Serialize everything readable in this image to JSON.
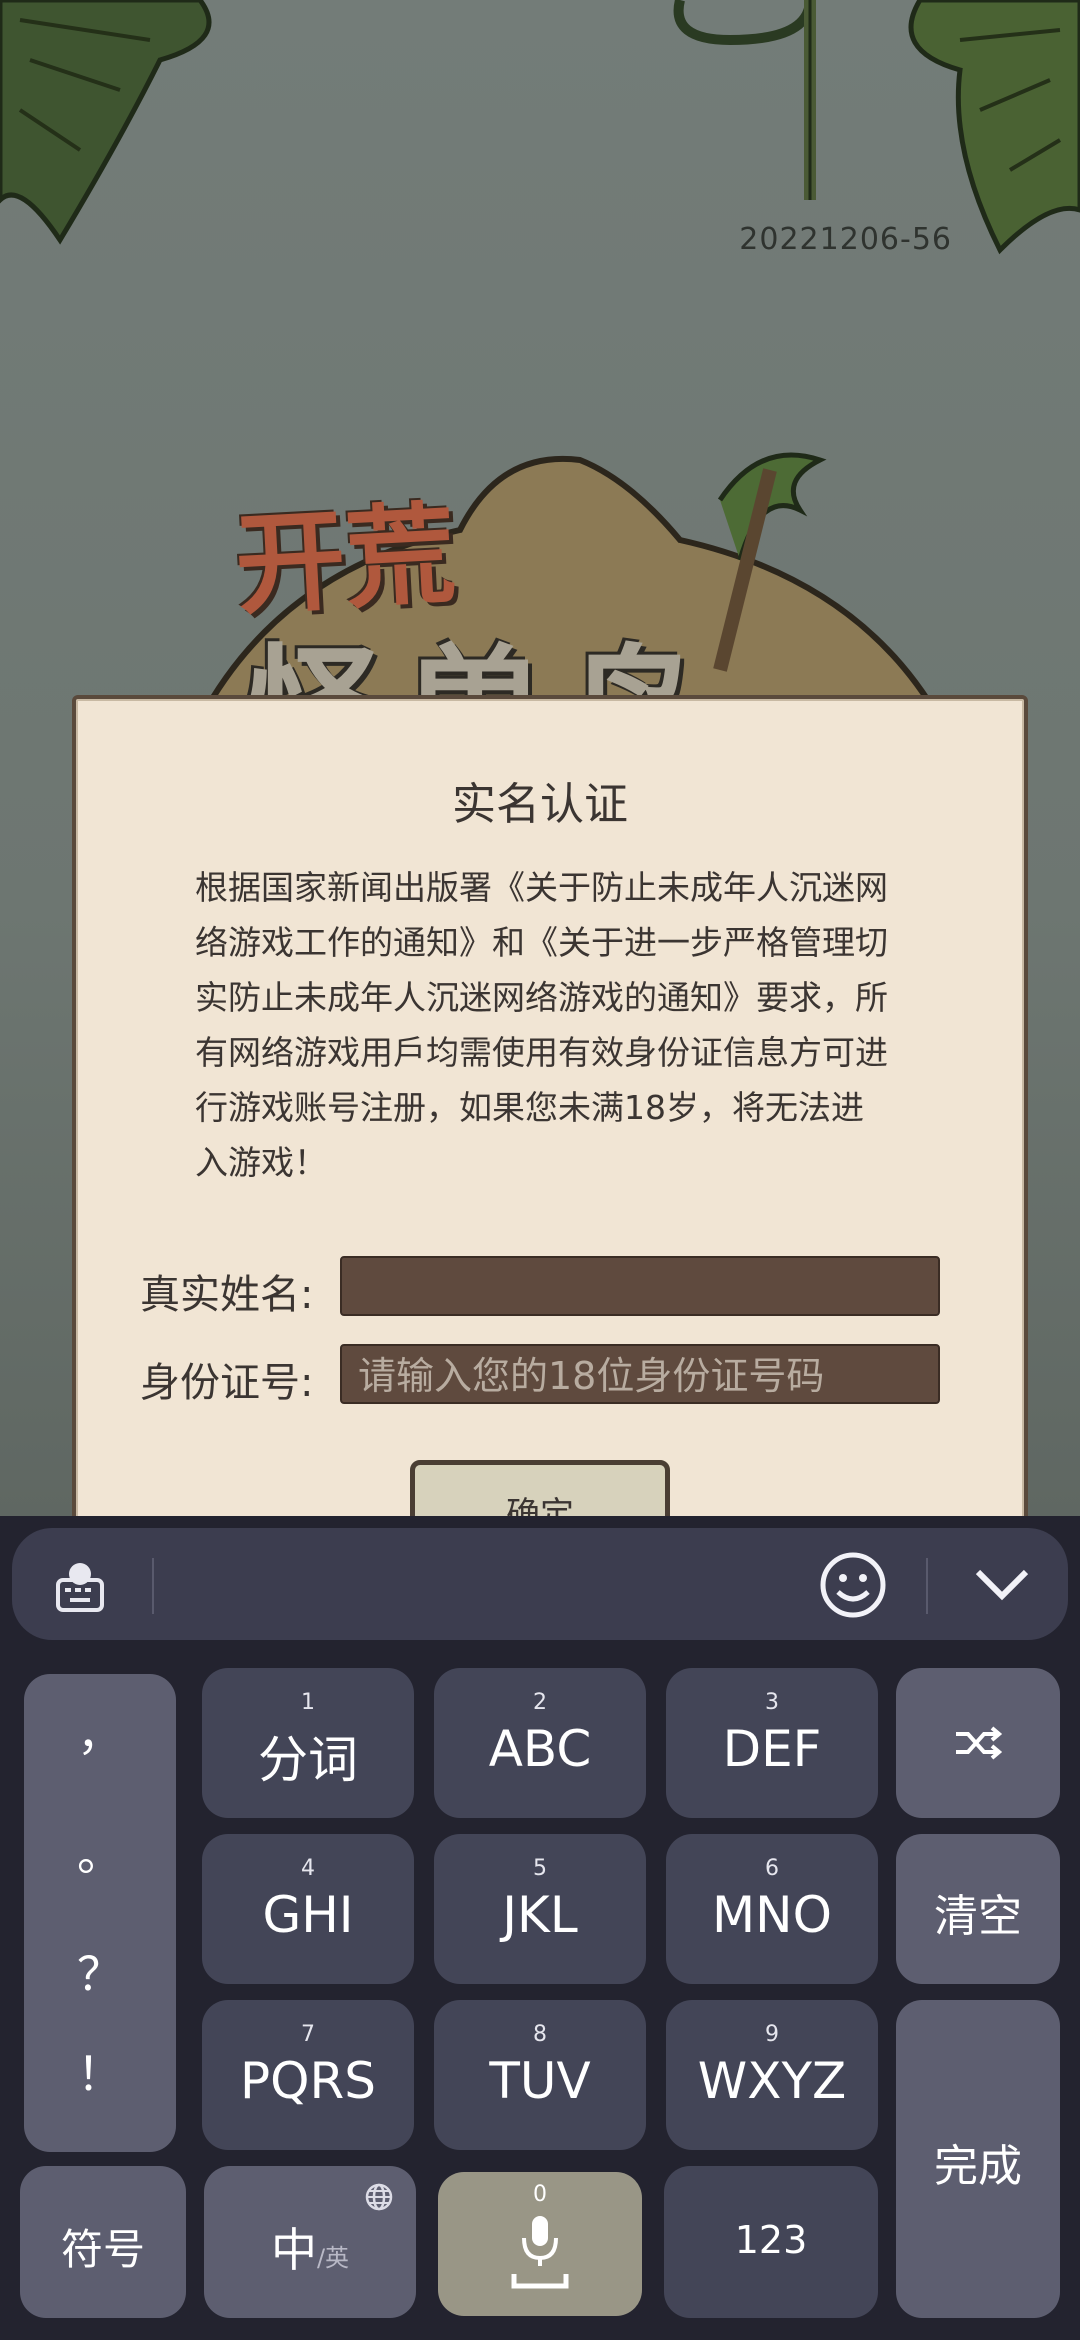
{
  "version": "20221206-56",
  "logo": {
    "line1": "开荒",
    "line2": "怪兽岛"
  },
  "dialog": {
    "title": "实名认证",
    "body": "根据国家新闻出版署《关于防止未成年人沉迷网络游戏工作的通知》和《关于进一步严格管理切实防止未成年人沉迷网络游戏的通知》要求，所有网络游戏用戶均需使用有效身份证信息方可进行游戏账号注册，如果您未满18岁，将无法进入游戏！",
    "name_label": "真实姓名:",
    "name_value": "",
    "id_label": "身份证号:",
    "id_placeholder": "请输入您的18位身份证号码",
    "confirm_label": "确定"
  },
  "keyboard": {
    "punct": [
      "，",
      "。",
      "？",
      "！"
    ],
    "keys": [
      {
        "num": "1",
        "label": "分词"
      },
      {
        "num": "2",
        "label": "ABC"
      },
      {
        "num": "3",
        "label": "DEF"
      },
      {
        "num": "4",
        "label": "GHI"
      },
      {
        "num": "5",
        "label": "JKL"
      },
      {
        "num": "6",
        "label": "MNO"
      },
      {
        "num": "7",
        "label": "PQRS"
      },
      {
        "num": "8",
        "label": "TUV"
      },
      {
        "num": "9",
        "label": "WXYZ"
      }
    ],
    "clear_label": "清空",
    "done_label": "完成",
    "symbol_label": "符号",
    "lang_label": "中",
    "lang_sub": "/英",
    "space_num": "0",
    "num_label": "123"
  },
  "colors": {
    "paper": "#f1e5d4",
    "input_bg": "#5f4a3e",
    "keyboard_bg": "#23232f",
    "key_bg": "#434557",
    "side_key_bg": "#5d5e70",
    "mic_key_bg": "#999686"
  },
  "icons": {
    "toolbar_left": "keyboard-globe-icon",
    "toolbar_emoji": "emoji-icon",
    "toolbar_collapse": "chevron-down-icon",
    "switch": "shuffle-icon",
    "globe": "globe-icon",
    "mic": "microphone-icon"
  }
}
